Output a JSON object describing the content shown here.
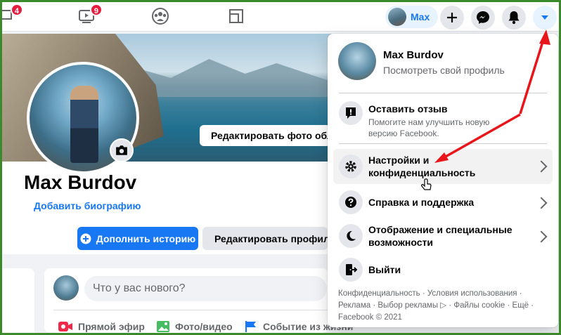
{
  "topbar": {
    "badges": {
      "left": "4",
      "watch": "9"
    },
    "user_chip": {
      "name": "Max"
    }
  },
  "profile": {
    "name": "Max Burdov",
    "bio_link": "Добавить биографию",
    "edit_cover_label": "Редактировать фото обл",
    "add_story_label": "Дополнить историю",
    "edit_profile_label": "Редактировать профиль"
  },
  "composer": {
    "placeholder": "Что у вас нового?",
    "actions": [
      "Прямой эфир",
      "Фото/видео",
      "Событие из жизни"
    ]
  },
  "dropdown": {
    "profile_name": "Max Burdov",
    "profile_sub": "Посмотреть свой профиль",
    "feedback_title": "Оставить отзыв",
    "feedback_sub": "Помогите нам улучшить новую версию Facebook.",
    "items": [
      {
        "label": "Настройки и конфиденциальность"
      },
      {
        "label": "Справка и поддержка"
      },
      {
        "label": "Отображение и специальные возможности"
      },
      {
        "label": "Выйти"
      }
    ],
    "footer": "Конфиденциальность · Условия использования · Реклама · Выбор рекламы ▷ · Файлы cookie · Ещё · Facebook © 2021"
  },
  "colors": {
    "accent": "#1877f2",
    "annotation_arrow": "#e8161b",
    "frame": "#3a8a2c"
  }
}
